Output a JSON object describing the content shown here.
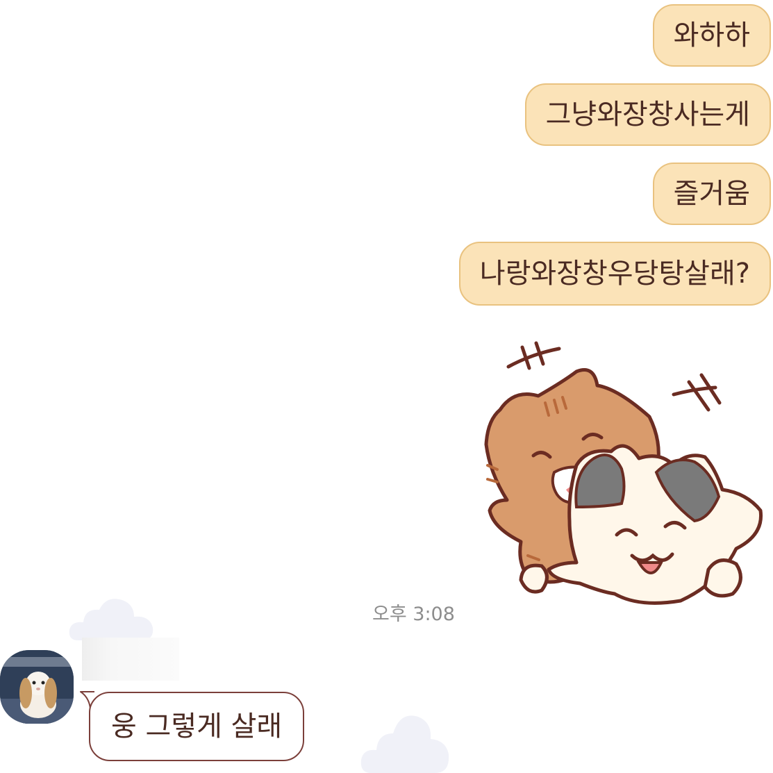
{
  "messages": {
    "outgoing": [
      {
        "text": "와하하"
      },
      {
        "text": "그냥와장창사는게"
      },
      {
        "text": "즐거움"
      },
      {
        "text": "나랑와장창우당탕살래?"
      }
    ],
    "timestamp": "오후 3:08",
    "incoming": [
      {
        "text": "웅 그렇게 살래"
      }
    ]
  },
  "sticker": {
    "name": "hugging-cats-sticker"
  },
  "colors": {
    "outgoing_bubble": "#fbe3b8",
    "outgoing_border": "#e9c27f",
    "incoming_border": "#7b3f3a",
    "text": "#4a2a22",
    "timestamp": "#8d8d8d"
  }
}
